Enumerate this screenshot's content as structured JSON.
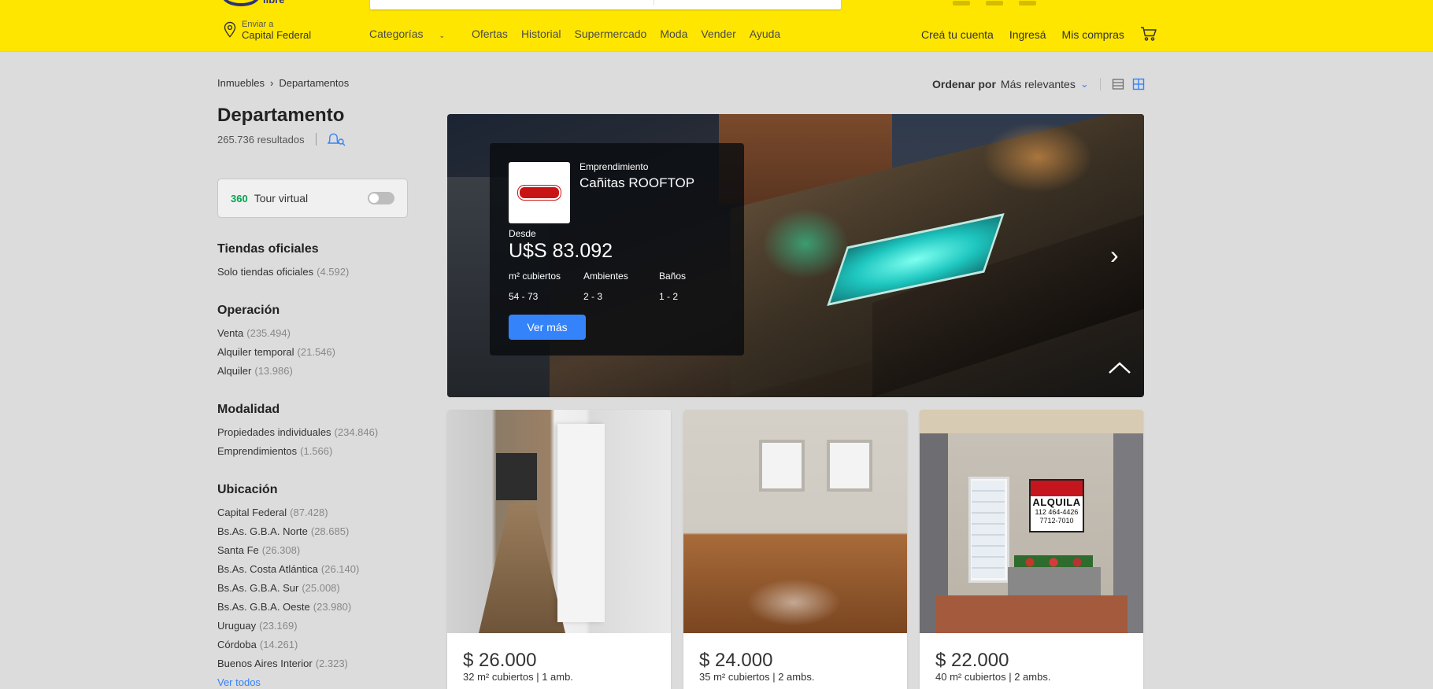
{
  "header": {
    "logo_text": "libre",
    "ship_to_label": "Enviar a",
    "ship_to_location": "Capital Federal",
    "nav": [
      "Categorías",
      "Ofertas",
      "Historial",
      "Supermercado",
      "Moda",
      "Vender",
      "Ayuda"
    ],
    "right_nav": [
      "Creá tu cuenta",
      "Ingresá",
      "Mis compras"
    ],
    "brand_color": "#ffe600"
  },
  "breadcrumb": [
    "Inmuebles",
    "Departamentos"
  ],
  "sort": {
    "label": "Ordenar por",
    "value": "Más relevantes"
  },
  "page": {
    "title": "Departamento",
    "results": "265.736 resultados"
  },
  "tour_virtual": {
    "label": "Tour virtual",
    "enabled": false,
    "icon_text": "360"
  },
  "filters": {
    "tiendas": {
      "title": "Tiendas oficiales",
      "items": [
        {
          "label": "Solo tiendas oficiales",
          "count": "(4.592)"
        }
      ]
    },
    "operacion": {
      "title": "Operación",
      "items": [
        {
          "label": "Venta",
          "count": "(235.494)"
        },
        {
          "label": "Alquiler temporal",
          "count": "(21.546)"
        },
        {
          "label": "Alquiler",
          "count": "(13.986)"
        }
      ]
    },
    "modalidad": {
      "title": "Modalidad",
      "items": [
        {
          "label": "Propiedades individuales",
          "count": "(234.846)"
        },
        {
          "label": "Emprendimientos",
          "count": "(1.566)"
        }
      ]
    },
    "ubicacion": {
      "title": "Ubicación",
      "items": [
        {
          "label": "Capital Federal",
          "count": "(87.428)"
        },
        {
          "label": "Bs.As. G.B.A. Norte",
          "count": "(28.685)"
        },
        {
          "label": "Santa Fe",
          "count": "(26.308)"
        },
        {
          "label": "Bs.As. Costa Atlántica",
          "count": "(26.140)"
        },
        {
          "label": "Bs.As. G.B.A. Sur",
          "count": "(25.008)"
        },
        {
          "label": "Bs.As. G.B.A. Oeste",
          "count": "(23.980)"
        },
        {
          "label": "Uruguay",
          "count": "(23.169)"
        },
        {
          "label": "Córdoba",
          "count": "(14.261)"
        },
        {
          "label": "Buenos Aires Interior",
          "count": "(2.323)"
        }
      ],
      "see_all": "Ver todos"
    }
  },
  "hero": {
    "kicker": "Emprendimiento",
    "name": "Cañitas ROOFTOP",
    "from_label": "Desde",
    "price": "U$S 83.092",
    "specs": [
      {
        "label": "m² cubiertos",
        "value": "54 - 73"
      },
      {
        "label": "Ambientes",
        "value": "2 - 3"
      },
      {
        "label": "Baños",
        "value": "1 - 2"
      }
    ],
    "cta": "Ver más"
  },
  "cards": [
    {
      "price": "$ 26.000",
      "desc": "32 m² cubiertos | 1 amb."
    },
    {
      "price": "$ 24.000",
      "desc": "35 m² cubiertos | 2 ambs."
    },
    {
      "price": "$ 22.000",
      "desc": "40 m² cubiertos | 2 ambs."
    }
  ],
  "sign": {
    "word": "ALQUILA",
    "phone1": "112 464-4426",
    "phone2": "7712-7010"
  }
}
